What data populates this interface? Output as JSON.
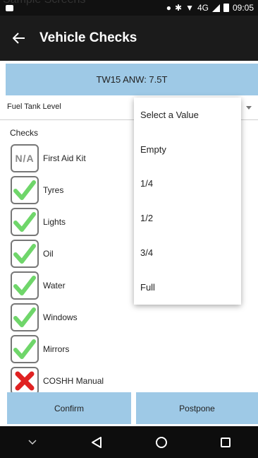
{
  "watermark": "Sample Screens",
  "statusbar": {
    "time": "09:05",
    "network": "4G",
    "icons": [
      "photo-icon",
      "location-icon",
      "bluetooth-icon",
      "wifi-icon",
      "signal-icon",
      "battery-icon"
    ]
  },
  "appbar": {
    "title": "Vehicle Checks",
    "back_icon": "arrow-left-icon"
  },
  "vehicle": {
    "label": "TW15 ANW: 7.5T"
  },
  "fuel": {
    "label": "Fuel Tank Level"
  },
  "checks": {
    "label": "Checks",
    "items": [
      {
        "label": "First Aid Kit",
        "status": "na",
        "status_text": "N/A"
      },
      {
        "label": "Tyres",
        "status": "pass"
      },
      {
        "label": "Lights",
        "status": "pass"
      },
      {
        "label": "Oil",
        "status": "pass"
      },
      {
        "label": "Water",
        "status": "pass"
      },
      {
        "label": "Windows",
        "status": "pass"
      },
      {
        "label": "Mirrors",
        "status": "pass"
      },
      {
        "label": "COSHH Manual",
        "status": "fail"
      }
    ]
  },
  "dropdown": {
    "options": [
      "Select a Value",
      "Empty",
      "1/4",
      "1/2",
      "3/4",
      "Full"
    ]
  },
  "actions": {
    "confirm": "Confirm",
    "postpone": "Postpone"
  },
  "colors": {
    "accent": "#9ec9e6",
    "pass": "#6fd66a",
    "fail": "#e02222",
    "appbar": "#1b1b1b"
  },
  "navbar": {
    "icons": [
      "chevron-down-icon",
      "back-triangle-icon",
      "home-circle-icon",
      "recents-square-icon"
    ]
  }
}
